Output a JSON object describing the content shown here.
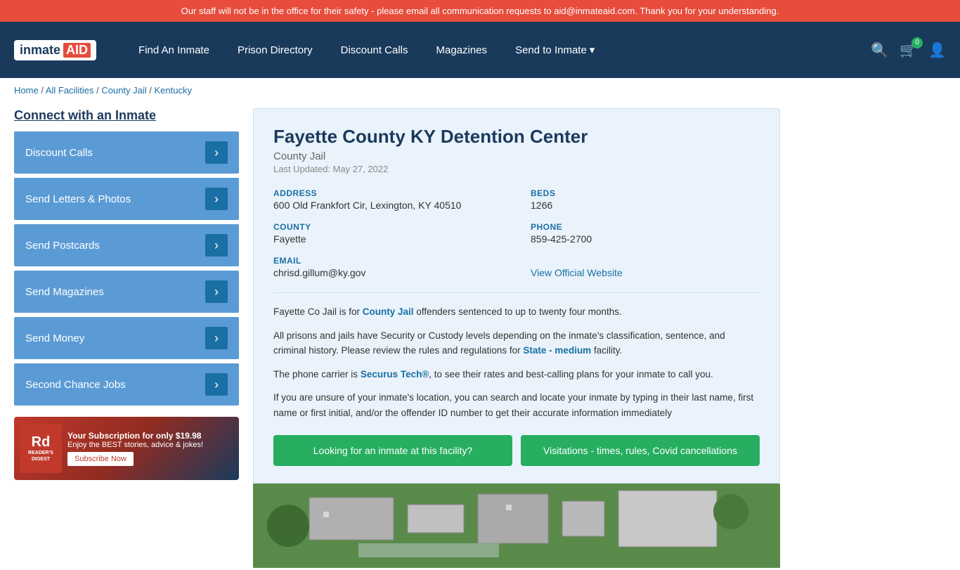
{
  "alert": {
    "text": "Our staff will not be in the office for their safety - please email all communication requests to aid@inmateaid.com. Thank you for your understanding."
  },
  "navbar": {
    "logo_inmate": "inmate",
    "logo_aid": "AID",
    "links": [
      {
        "label": "Find An Inmate",
        "id": "find-inmate"
      },
      {
        "label": "Prison Directory",
        "id": "prison-directory"
      },
      {
        "label": "Discount Calls",
        "id": "discount-calls"
      },
      {
        "label": "Magazines",
        "id": "magazines"
      },
      {
        "label": "Send to Inmate",
        "id": "send-to-inmate",
        "has_dropdown": true
      }
    ],
    "cart_count": "0"
  },
  "breadcrumb": {
    "items": [
      "Home",
      "All Facilities",
      "County Jail",
      "Kentucky"
    ]
  },
  "sidebar": {
    "title": "Connect with an Inmate",
    "buttons": [
      {
        "label": "Discount Calls",
        "id": "btn-discount-calls"
      },
      {
        "label": "Send Letters & Photos",
        "id": "btn-letters"
      },
      {
        "label": "Send Postcards",
        "id": "btn-postcards"
      },
      {
        "label": "Send Magazines",
        "id": "btn-magazines"
      },
      {
        "label": "Send Money",
        "id": "btn-money"
      },
      {
        "label": "Second Chance Jobs",
        "id": "btn-jobs"
      }
    ],
    "ad": {
      "logo_line1": "Rd",
      "logo_line2": "READER'S DIGEST",
      "headline": "Your Subscription for only $19.98",
      "subtext": "Enjoy the BEST stories, advice & jokes!",
      "cta": "Subscribe Now"
    }
  },
  "facility": {
    "name": "Fayette County KY Detention Center",
    "type": "County Jail",
    "last_updated": "Last Updated: May 27, 2022",
    "address_label": "ADDRESS",
    "address_value": "600 Old Frankfort Cir, Lexington, KY 40510",
    "beds_label": "BEDS",
    "beds_value": "1266",
    "county_label": "COUNTY",
    "county_value": "Fayette",
    "phone_label": "PHONE",
    "phone_value": "859-425-2700",
    "email_label": "EMAIL",
    "email_value": "chrisd.gillum@ky.gov",
    "website_label": "View Official Website",
    "website_url": "#",
    "desc1": "Fayette Co Jail is for County Jail offenders sentenced to up to twenty four months.",
    "desc2": "All prisons and jails have Security or Custody levels depending on the inmate's classification, sentence, and criminal history. Please review the rules and regulations for State - medium facility.",
    "desc3": "The phone carrier is Securus Tech®, to see their rates and best-calling plans for your inmate to call you.",
    "desc4": "If you are unsure of your inmate's location, you can search and locate your inmate by typing in their last name, first name or first initial, and/or the offender ID number to get their accurate information immediately",
    "btn_looking": "Looking for an inmate at this facility?",
    "btn_visitations": "Visitations - times, rules, Covid cancellations"
  }
}
